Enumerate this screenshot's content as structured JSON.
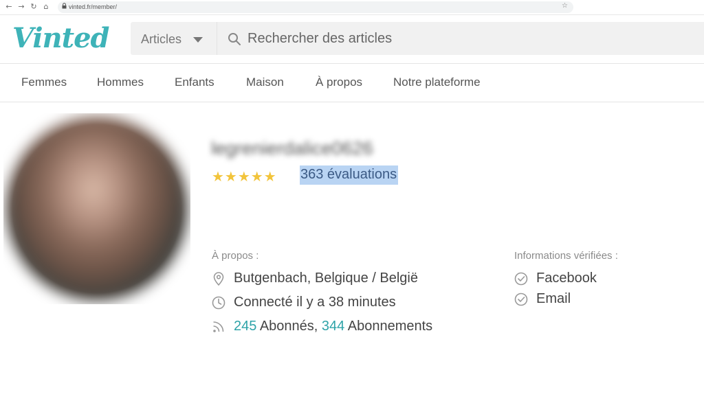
{
  "browser": {
    "url": "vinted.fr/member/"
  },
  "header": {
    "logo": "Vinted",
    "category_select": "Articles",
    "search_placeholder": "Rechercher des articles"
  },
  "nav": {
    "items": [
      "Femmes",
      "Hommes",
      "Enfants",
      "Maison",
      "À propos",
      "Notre plateforme"
    ]
  },
  "profile": {
    "username": "legrenierdalice0626",
    "stars": "★★★★★",
    "rating_stars": 5,
    "ratings_link": "363 évaluations",
    "about_label": "À propos :",
    "location": "Butgenbach, Belgique / België",
    "last_seen": "Connecté il y a 38 minutes",
    "followers_count": "245",
    "followers_label": " Abonnés, ",
    "following_count": "344",
    "following_label": " Abonnements",
    "verified_label": "Informations vérifiées :",
    "verified": [
      "Facebook",
      "Email"
    ]
  },
  "colors": {
    "brand": "#3eb3b8",
    "star": "#f2c43b",
    "teal_link": "#2ea3a8",
    "selection": "#b9d4f3"
  }
}
